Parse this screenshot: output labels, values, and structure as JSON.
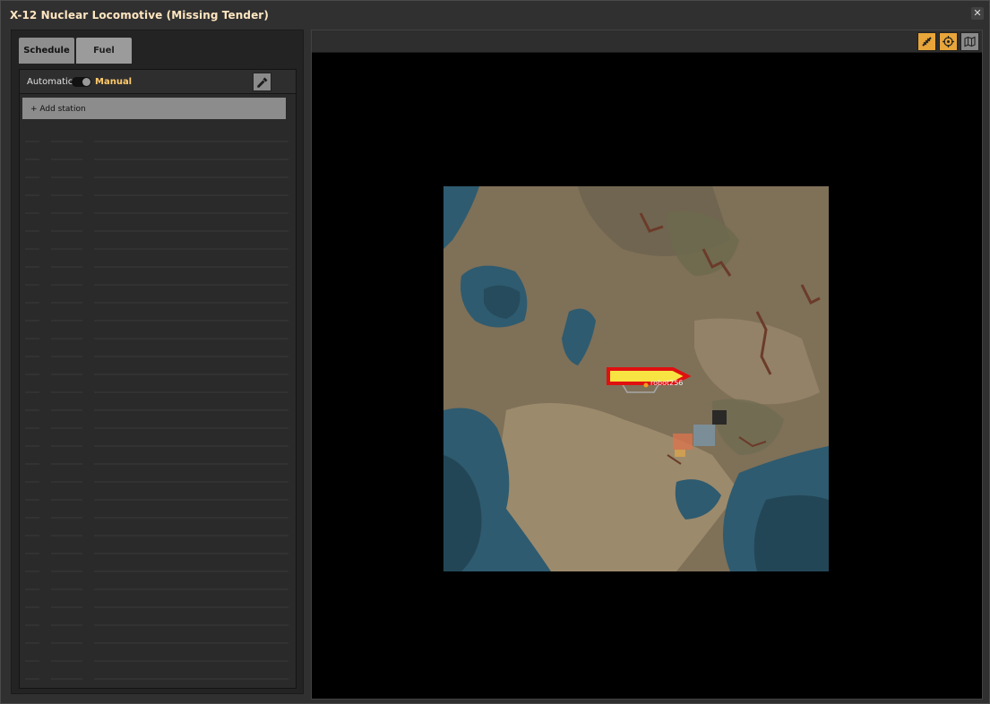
{
  "window": {
    "title": "X-12 Nuclear Locomotive (Missing Tender)",
    "close_icon": "✕"
  },
  "tabs": [
    {
      "label": "Schedule",
      "active": true
    },
    {
      "label": "Fuel",
      "active": false
    }
  ],
  "schedule": {
    "mode_automatic": "Automatic",
    "mode_manual": "Manual",
    "mode_selected": "Manual",
    "add_station_label": "+ Add station"
  },
  "minimap": {
    "toolbar": [
      {
        "icon": "rail-icon",
        "active": true
      },
      {
        "icon": "target-icon",
        "active": true
      },
      {
        "icon": "map-icon",
        "active": false
      }
    ],
    "player_label": "robot256"
  },
  "colors": {
    "accent": "#ffcb6b",
    "toggle_on": "#e8a53a",
    "train_marker": "#f7e342",
    "train_outline": "#e01010",
    "water": "#2c5a6e",
    "land": "#8a7a5e"
  }
}
